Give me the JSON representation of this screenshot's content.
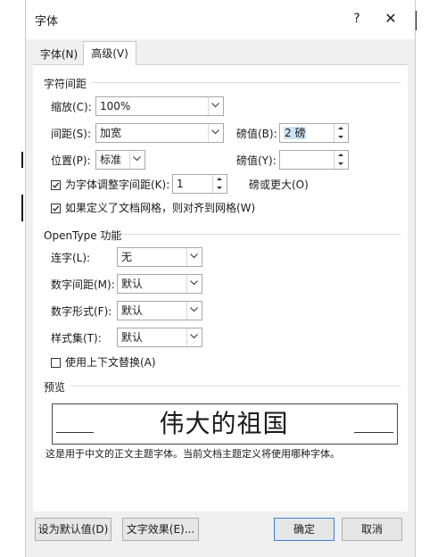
{
  "dialog": {
    "title": "字体",
    "help": "?",
    "close": "✕"
  },
  "tabs": [
    {
      "label": "字体(N)",
      "active": false
    },
    {
      "label": "高级(V)",
      "active": true
    }
  ],
  "spacing": {
    "section": "字符间距",
    "scale_label": "缩放(C):",
    "scale_value": "100%",
    "spacing_label": "间距(S):",
    "spacing_value": "加宽",
    "spacing_pt_label": "磅值(B):",
    "spacing_pt_value": "2 磅",
    "position_label": "位置(P):",
    "position_value": "标准",
    "position_pt_label": "磅值(Y):",
    "position_pt_value": "",
    "kerning_label": "为字体调整字间距(K):",
    "kerning_checked": true,
    "kerning_value": "1",
    "kerning_suffix": "磅或更大(O)",
    "grid_label": "如果定义了文档网格，则对齐到网格(W)",
    "grid_checked": true
  },
  "opentype": {
    "section": "OpenType 功能",
    "ligatures_label": "连字(L):",
    "ligatures_value": "无",
    "numspacing_label": "数字间距(M):",
    "numspacing_value": "默认",
    "numform_label": "数字形式(F):",
    "numform_value": "默认",
    "stylistic_label": "样式集(T):",
    "stylistic_value": "默认",
    "contextual_label": "使用上下文替换(A)",
    "contextual_checked": false
  },
  "preview": {
    "section": "预览",
    "sample": "伟大的祖国",
    "note": "这是用于中文的正文主题字体。当前文档主题定义将使用哪种字体。"
  },
  "buttons": {
    "default": "设为默认值(D)",
    "effects": "文字效果(E)...",
    "ok": "确定",
    "cancel": "取消"
  }
}
